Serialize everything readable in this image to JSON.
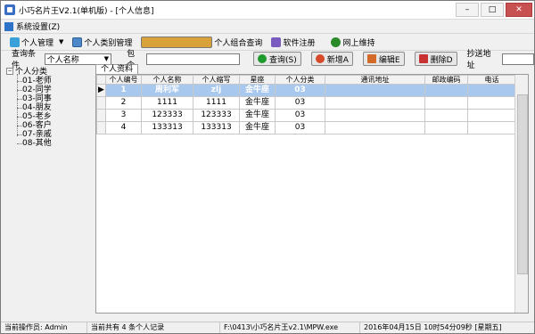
{
  "window": {
    "title": "小巧名片王V2.1(单机版) - [个人信息]",
    "min": "–",
    "max": "□",
    "close": "✕"
  },
  "menubar": {
    "system_settings": "系统设置(Z)"
  },
  "toolbar": {
    "personal_mgmt": "个人管理",
    "personal_category_mgmt": "个人类别管理",
    "personal_combo_query": "个人组合查询",
    "software_register": "软件注册",
    "online_maintenance": "网上维持"
  },
  "query": {
    "condition_label": "查询条件",
    "condition_value": "个人名称",
    "contains_label": "包含",
    "query_button": "查询(S)",
    "new_button": "新增A",
    "edit_button": "编辑E",
    "delete_button": "删除D",
    "cc_address_label": "抄送地址"
  },
  "tree": {
    "root": "个人分类",
    "items": [
      "01-老师",
      "02-同学",
      "03-同事",
      "04-朋友",
      "05-老乡",
      "06-客户",
      "07-亲戚",
      "08-其他"
    ]
  },
  "tab": {
    "personal_data": "个人资料"
  },
  "table": {
    "headers": [
      "个人编号",
      "个人名称",
      "个人缩写",
      "星座",
      "个人分类",
      "通讯地址",
      "邮政编码",
      "电话"
    ],
    "rows": [
      [
        "1",
        "周利军",
        "zlj",
        "金牛座",
        "03",
        "",
        "",
        ""
      ],
      [
        "2",
        "1111",
        "1111",
        "金牛座",
        "03",
        "",
        "",
        ""
      ],
      [
        "3",
        "123333",
        "123333",
        "金牛座",
        "03",
        "",
        "",
        ""
      ],
      [
        "4",
        "133313",
        "133313",
        "金牛座",
        "03",
        "",
        "",
        ""
      ]
    ]
  },
  "status": {
    "operator": "当前操作员: Admin",
    "count": "当前共有 4 条个人记录",
    "path": "F:\\0413\\小巧名片王v2.1\\MPW.exe",
    "datetime": "2016年04月15日 10时54分09秒 [星期五]"
  },
  "icons": {
    "app": "app-icon",
    "users": "users-icon",
    "category": "category-icon",
    "combo_query": "combo-query-icon",
    "register": "register-icon",
    "globe": "globe-icon",
    "search": "search-icon",
    "add": "add-icon",
    "edit": "edit-icon",
    "delete": "delete-icon"
  }
}
